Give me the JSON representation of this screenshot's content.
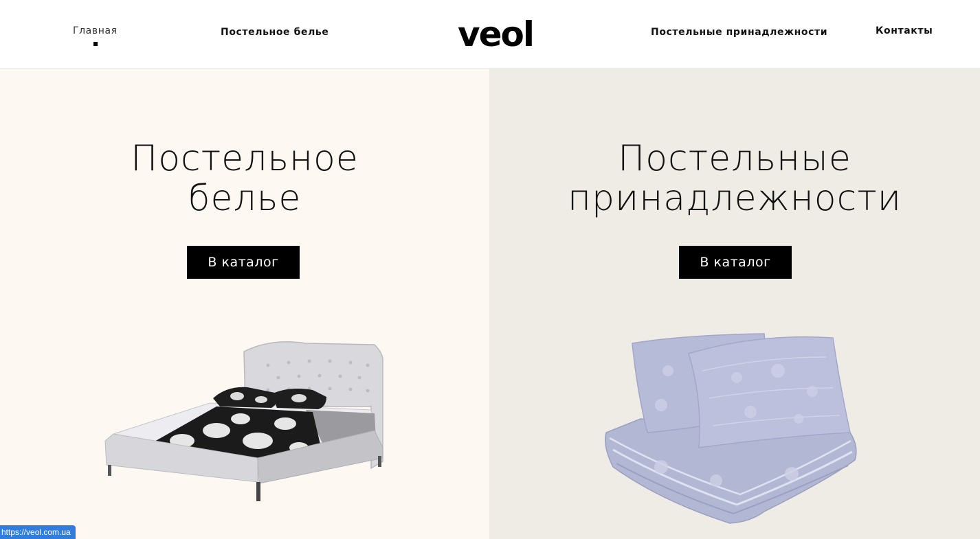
{
  "header": {
    "logo_text": "veol",
    "nav": {
      "home": "Главная",
      "bedding": "Постельное белье",
      "accessories": "Постельные принадлежности",
      "contacts": "Контакты"
    },
    "active_item": "home"
  },
  "panels": {
    "left": {
      "title_line1": "Постельное",
      "title_line2": "белье",
      "button_label": "В каталог",
      "background": "#fdf8f2"
    },
    "right": {
      "title_line1": "Постельные",
      "title_line2": "принадлежности",
      "button_label": "В каталог",
      "background": "#efece6"
    }
  },
  "status_bar": {
    "url": "https://veol.com.ua"
  },
  "colors": {
    "button_bg": "#000000",
    "button_text": "#ffffff",
    "status_bg": "#2f7de1"
  }
}
